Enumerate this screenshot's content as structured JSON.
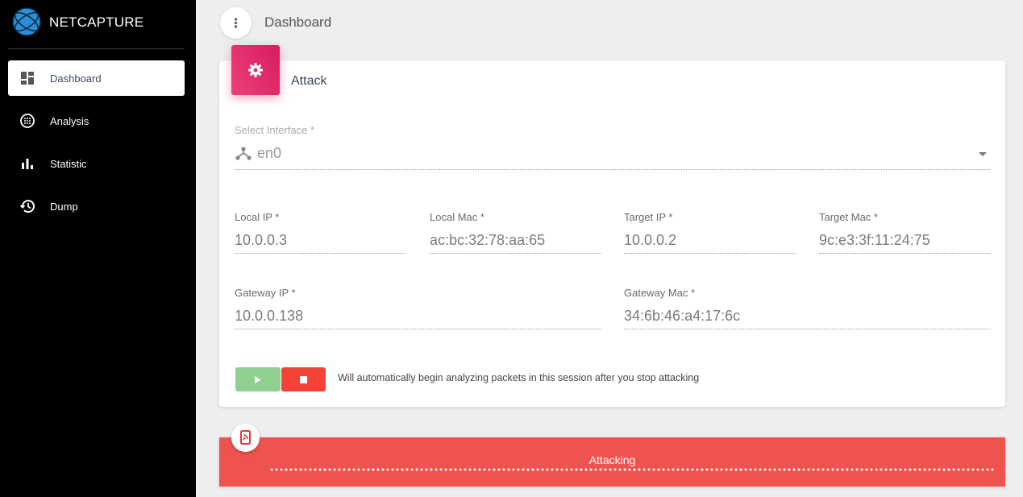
{
  "app": {
    "name": "NETCAPTURE"
  },
  "sidebar": {
    "items": [
      {
        "label": "Dashboard",
        "icon": "dashboard-icon",
        "active": true
      },
      {
        "label": "Analysis",
        "icon": "analysis-icon",
        "active": false
      },
      {
        "label": "Statistic",
        "icon": "bar-chart-icon",
        "active": false
      },
      {
        "label": "Dump",
        "icon": "history-icon",
        "active": false
      }
    ]
  },
  "header": {
    "title": "Dashboard"
  },
  "card": {
    "title": "Attack",
    "interface": {
      "label": "Select Interface *",
      "value": "en0"
    },
    "local_ip": {
      "label": "Local IP *",
      "value": "10.0.0.3"
    },
    "local_mac": {
      "label": "Local Mac *",
      "value": "ac:bc:32:78:aa:65"
    },
    "target_ip": {
      "label": "Target IP *",
      "value": "10.0.0.2"
    },
    "target_mac": {
      "label": "Target Mac *",
      "value": "9c:e3:3f:11:24:75"
    },
    "gateway_ip": {
      "label": "Gateway IP *",
      "value": "10.0.0.138"
    },
    "gateway_mac": {
      "label": "Gateway Mac *",
      "value": "34:6b:46:a4:17:6c"
    },
    "hint": "Will automatically begin analyzing packets in this session after you stop attacking"
  },
  "status": {
    "text": "Attacking"
  },
  "colors": {
    "accent_pink": "#e91e63",
    "status_red": "#ef5350",
    "play_green": "#8fcf8f",
    "stop_red": "#f44336"
  }
}
